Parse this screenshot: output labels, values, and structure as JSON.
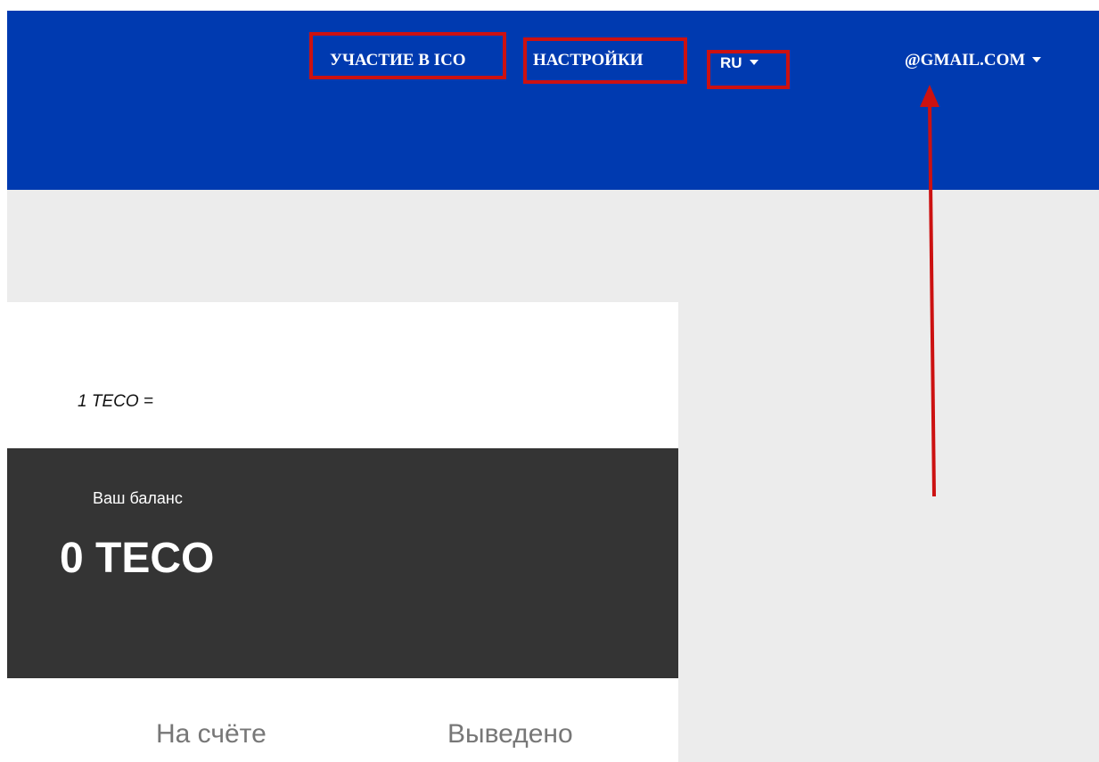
{
  "header": {
    "nav": {
      "ico_label": "УЧАСТИЕ В ICO",
      "settings_label": "НАСТРОЙКИ",
      "language_label": "RU",
      "account_email": "@GMAIL.COM"
    }
  },
  "rate": {
    "text": "1 TECO ="
  },
  "balance": {
    "label": "Ваш баланс",
    "value": "0 TECO"
  },
  "stats": {
    "on_account_label": "На счёте",
    "withdrawn_label": "Выведено"
  },
  "colors": {
    "header_background": "#003ab0",
    "highlight_border": "#cc1111",
    "balance_card_background": "#343434",
    "page_background": "#ececec"
  }
}
